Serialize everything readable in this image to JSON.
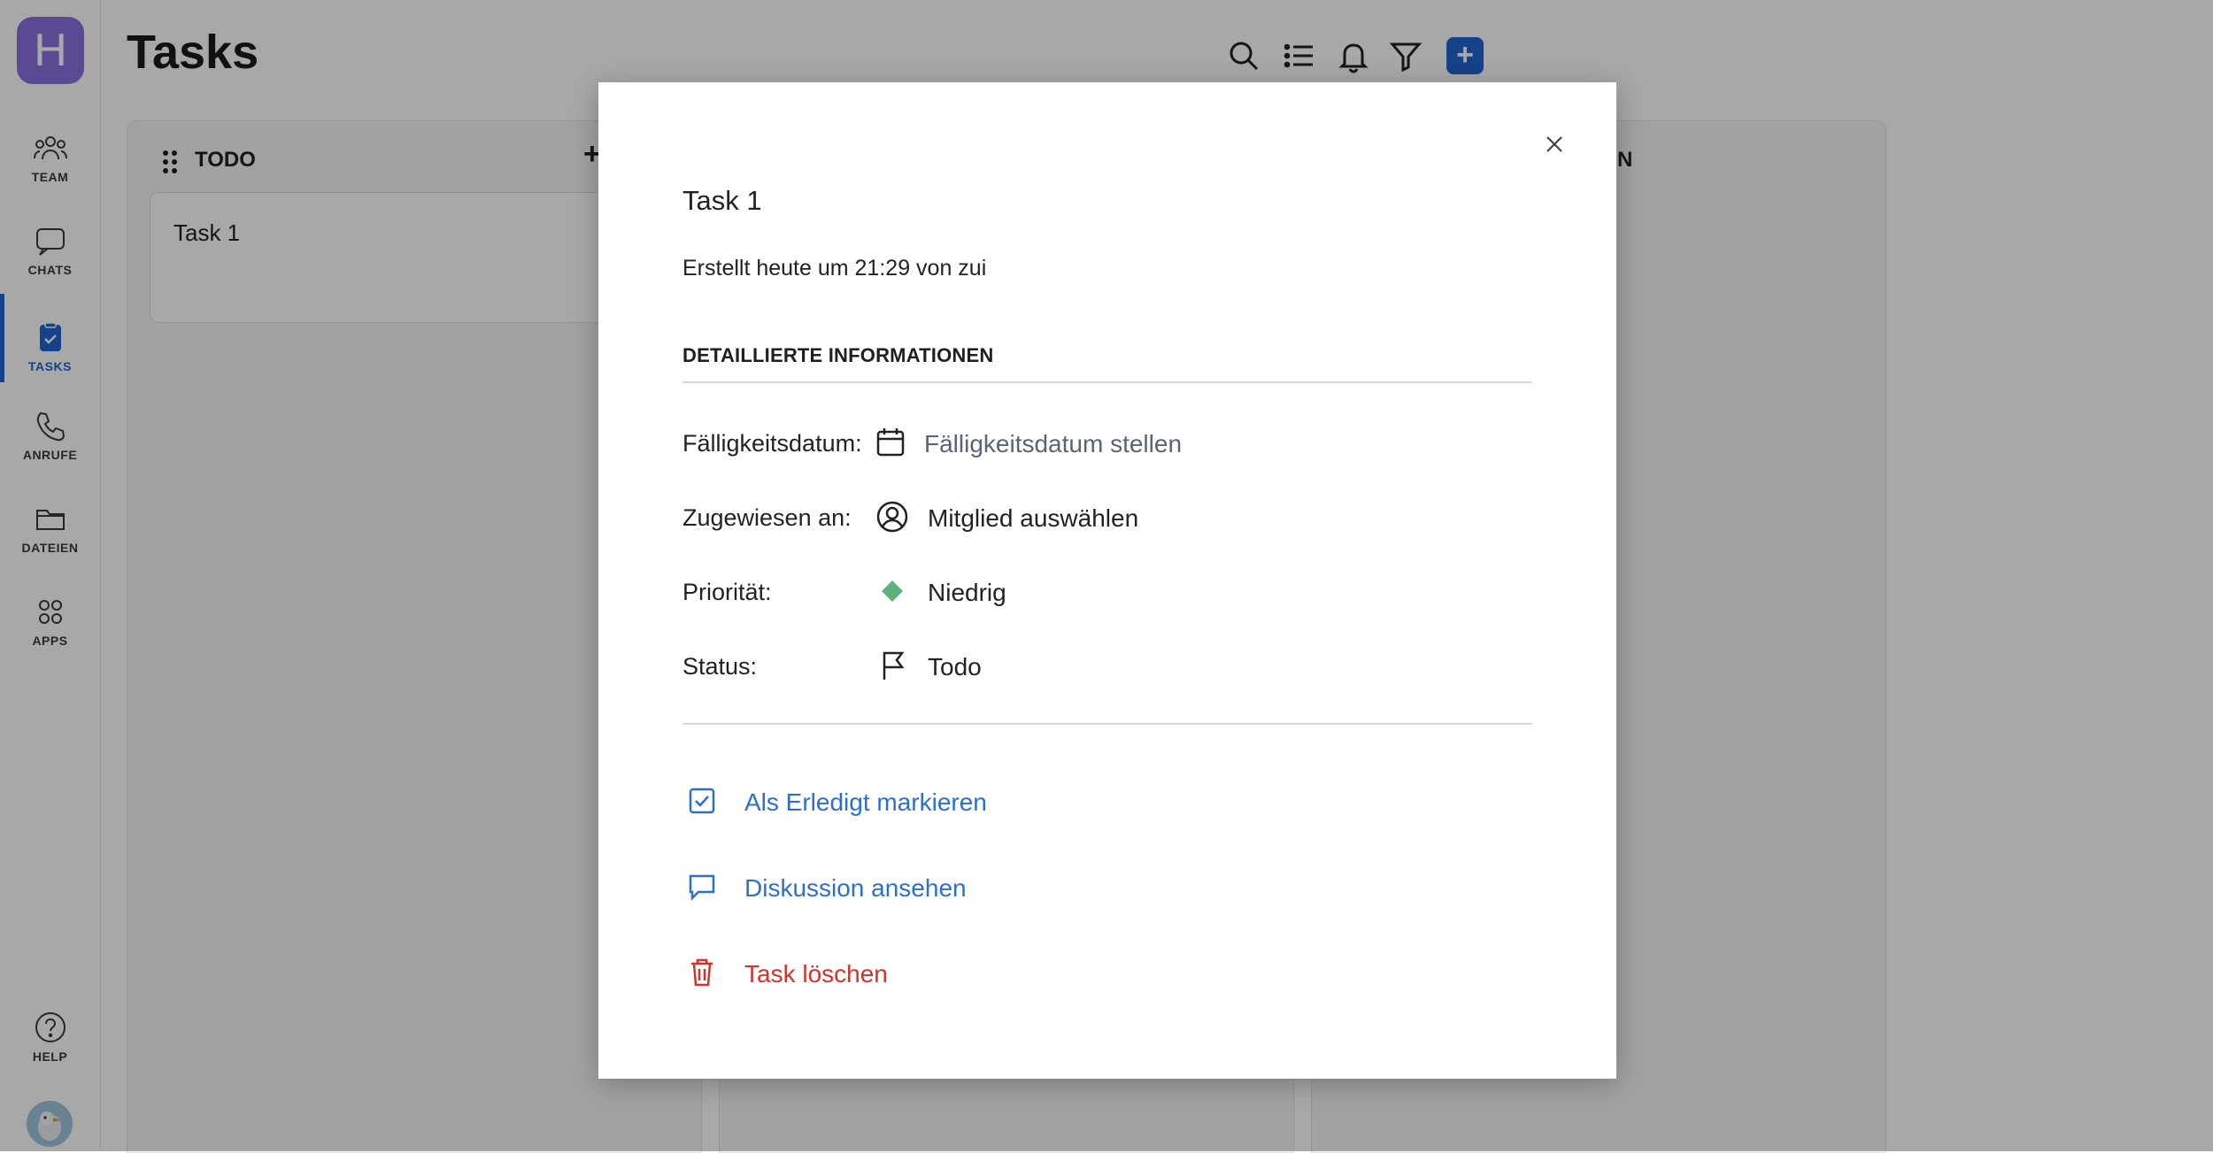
{
  "sidebar": {
    "workspace_initial": "H",
    "items": [
      {
        "label": "TEAM"
      },
      {
        "label": "CHATS"
      },
      {
        "label": "TASKS"
      },
      {
        "label": "ANRUFE"
      },
      {
        "label": "DATEIEN"
      },
      {
        "label": "APPS"
      }
    ],
    "help_label": "HELP"
  },
  "header": {
    "title": "Tasks",
    "add_label": "+"
  },
  "board": {
    "columns": [
      {
        "title": "TODO",
        "add_label": "+",
        "cards": [
          {
            "title": "Task 1"
          }
        ]
      },
      {
        "title": ""
      },
      {
        "title": "N"
      }
    ]
  },
  "modal": {
    "title": "Task 1",
    "meta": "Erstellt heute um 21:29 von zui",
    "section_heading": "DETAILLIERTE INFORMATIONEN",
    "fields": {
      "due": {
        "label": "Fälligkeitsdatum:",
        "value": "Fälligkeitsdatum stellen",
        "icon": "calendar-icon"
      },
      "assignee": {
        "label": "Zugewiesen an:",
        "value": "Mitglied auswählen",
        "icon": "user-circle-icon"
      },
      "priority": {
        "label": "Priorität:",
        "value": "Niedrig",
        "icon": "priority-diamond-icon",
        "color": "#5cb37a"
      },
      "status": {
        "label": "Status:",
        "value": "Todo",
        "icon": "flag-icon"
      }
    },
    "actions": {
      "complete": {
        "label": "Als Erledigt markieren",
        "icon": "checkbox-icon"
      },
      "discussion": {
        "label": "Diskussion ansehen",
        "icon": "chat-bubble-icon"
      },
      "delete": {
        "label": "Task löschen",
        "icon": "trash-icon"
      }
    }
  },
  "colors": {
    "accent": "#2264d1",
    "link": "#2b6fd1",
    "danger": "#d0342c",
    "workspace": "#8b6fe0"
  }
}
